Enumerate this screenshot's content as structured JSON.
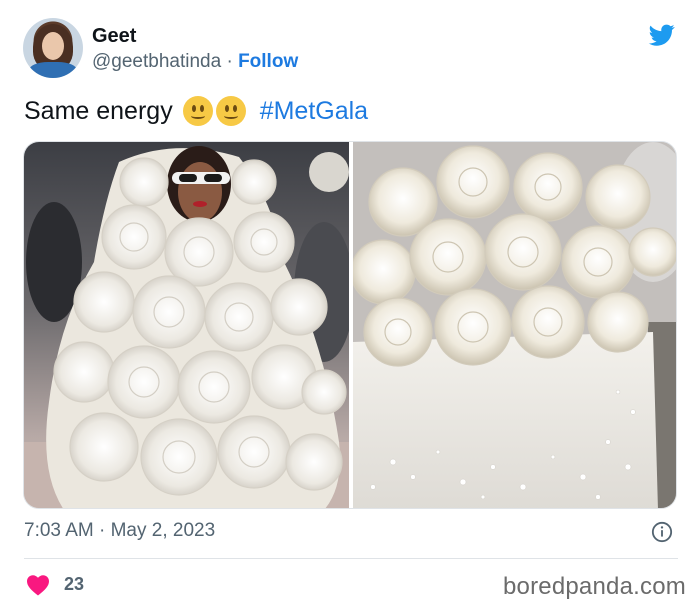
{
  "user": {
    "display_name": "Geet",
    "handle": "@geetbhatinda",
    "separator": " · ",
    "follow_label": "Follow"
  },
  "tweet": {
    "text": "Same energy",
    "emojis": [
      "slightly-smiling-face",
      "slightly-smiling-face"
    ],
    "hashtag": "#MetGala",
    "time": "7:03 AM",
    "date": "May 2, 2023",
    "meta_separator": " · ",
    "like_count": "23"
  },
  "media": [
    {
      "name": "white-floral-gown-photo"
    },
    {
      "name": "white-buttercream-rose-cake-photo"
    }
  ],
  "watermark": "boredpanda.com",
  "colors": {
    "link": "#1d7ae0",
    "twitter_bird": "#1d9bf0",
    "heart": "#f91880",
    "secondary_text": "#536471"
  },
  "icons": {
    "brand": "twitter-bird-icon",
    "info": "info-icon",
    "like": "heart-icon"
  }
}
